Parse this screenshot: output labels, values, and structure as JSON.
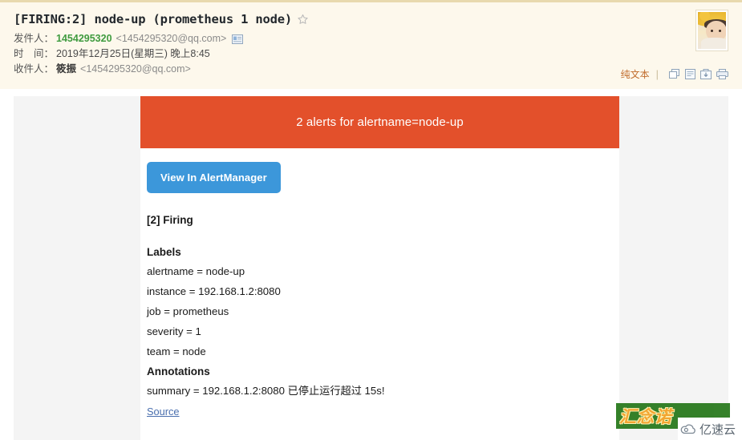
{
  "mail": {
    "subject": "[FIRING:2] node-up (prometheus 1 node)",
    "star_icon": "star-outline-icon",
    "sender_label": "发件人：",
    "sender_name": "1454295320",
    "sender_address": "<1454295320@qq.com>",
    "sender_card_icon": "contact-card-icon",
    "date_label": "时　间：",
    "date_value": "2019年12月25日(星期三) 晚上8:45",
    "recipient_label": "收件人：",
    "recipient_name": "筱振",
    "recipient_address": "<1454295320@qq.com>",
    "avatar": "user-avatar"
  },
  "toolbar": {
    "plain_text_label": "纯文本",
    "separator": "|",
    "icons": [
      {
        "name": "forward-icon"
      },
      {
        "name": "note-icon"
      },
      {
        "name": "save-icon"
      },
      {
        "name": "print-icon"
      }
    ]
  },
  "alert": {
    "banner_text": "2 alerts for alertname=node-up",
    "banner_color": "#e3502b",
    "button_label": "View In AlertManager",
    "button_color": "#3c97da",
    "firing_heading": "[2] Firing",
    "labels_heading": "Labels",
    "labels": [
      "alertname = node-up",
      "instance = 192.168.1.2:8080",
      "job = prometheus",
      "severity = 1",
      "team = node"
    ],
    "annotations_heading": "Annotations",
    "annotations": [
      "summary = 192.168.1.2:8080 已停止运行超过 15s!"
    ],
    "source_link_label": "Source",
    "source_link_color": "#4a6fae"
  },
  "watermarks": {
    "green_text": "汇念诺",
    "green_bg": "#2e7d23",
    "cloud_text": "亿速云",
    "cloud_icon": "cloud-icon"
  }
}
